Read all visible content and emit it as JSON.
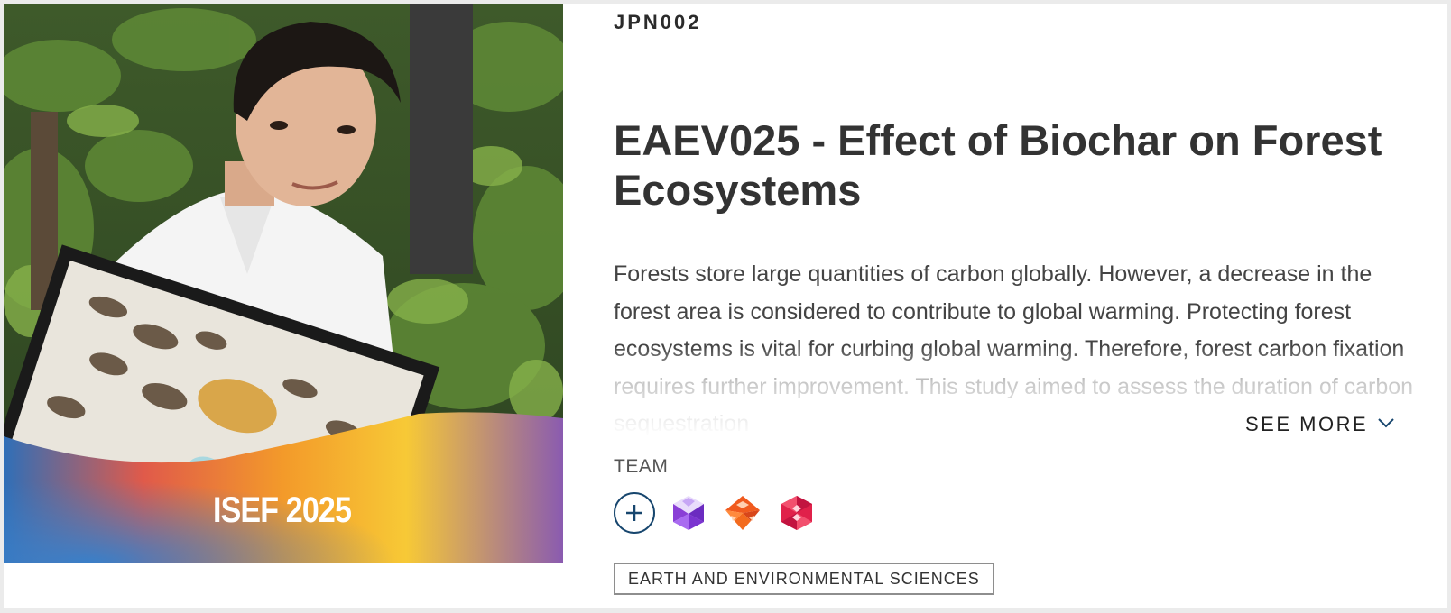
{
  "project": {
    "code": "JPN002",
    "title": "EAEV025 - Effect of Biochar on Forest Ecosystems",
    "abstract": "Forests store large quantities of carbon globally. However, a decrease in the forest area is considered to contribute to global warming. Protecting forest ecosystems is vital for curbing global warming. Therefore, forest carbon fixation requires further improvement. This study aimed to assess the duration of carbon sequestration",
    "see_more_label": "SEE MORE",
    "category": "EARTH AND ENVIRONMENTAL SCIENCES"
  },
  "photo": {
    "badge_text": "ISEF 2025"
  },
  "team": {
    "label": "TEAM",
    "add_icon": "plus-circle-icon",
    "avatars": [
      {
        "icon": "purple-geometric-avatar",
        "color": "#8a3fd6"
      },
      {
        "icon": "orange-geometric-avatar",
        "color": "#f05a1e"
      },
      {
        "icon": "red-geometric-avatar",
        "color": "#e0214a"
      }
    ]
  },
  "colors": {
    "title": "#333333",
    "add_button": "#17466e",
    "tag_border": "#8e8e8e"
  }
}
